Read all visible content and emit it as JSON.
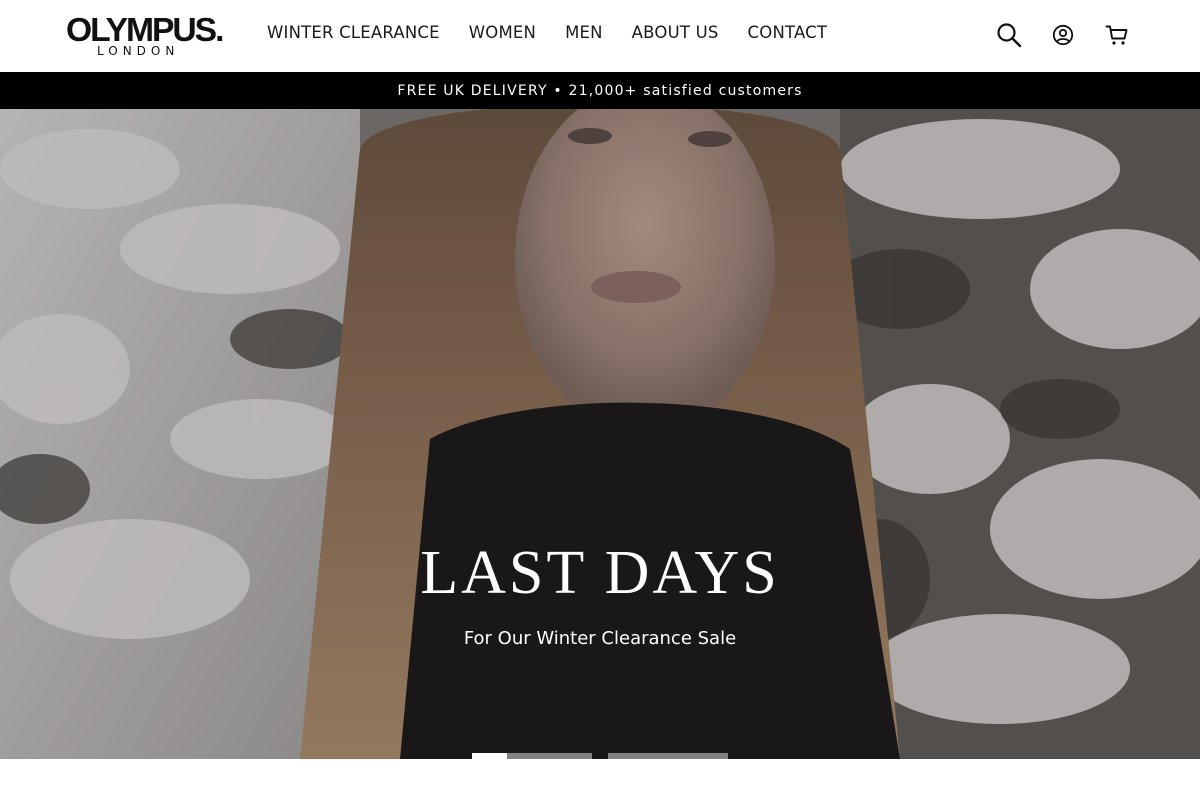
{
  "brand": {
    "logo_main": "OLYMPUS.",
    "logo_sub": "LONDON"
  },
  "nav": {
    "items": [
      {
        "label": "WINTER CLEARANCE"
      },
      {
        "label": "WOMEN"
      },
      {
        "label": "MEN"
      },
      {
        "label": "ABOUT US"
      },
      {
        "label": "CONTACT"
      }
    ]
  },
  "icons": [
    "search-icon",
    "account-icon",
    "cart-icon"
  ],
  "announcement": {
    "text": "FREE UK DELIVERY • 21,000+ satisfied customers"
  },
  "hero": {
    "title": "LAST DAYS",
    "subtitle": "For Our Winter Clearance Sale",
    "slides": [
      {
        "progress": 0.29
      },
      {
        "progress": 0
      }
    ]
  },
  "colors": {
    "announcement_bg": "#000000",
    "text_light": "#ffffff",
    "text_dark": "#1a1a1a"
  }
}
